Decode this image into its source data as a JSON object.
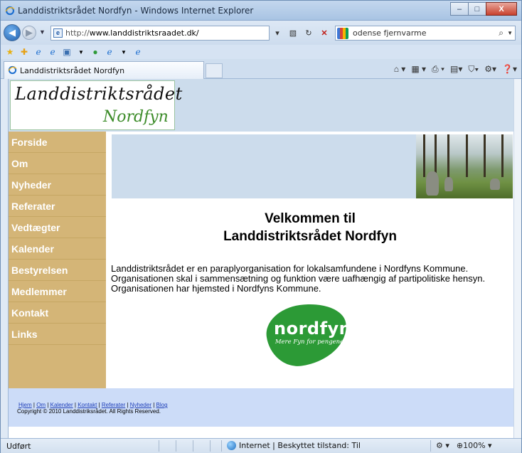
{
  "window": {
    "title": "Landdistriktsrådet Nordfyn - Windows Internet Explorer",
    "controls": {
      "minimize": "–",
      "maximize": "□",
      "close": "X"
    }
  },
  "address": {
    "url_prefix": "http://",
    "url_host": "www.landdistriktsraadet.dk/",
    "search_query": "odense fjernvarme"
  },
  "tab": {
    "label": "Landdistriktsrådet Nordfyn"
  },
  "site": {
    "logo_line1": "Landdistriktsrådet",
    "logo_line2": "Nordfyn",
    "menu": [
      "Forside",
      "Om",
      "Nyheder",
      "Referater",
      "Vedtægter",
      "Kalender",
      "Bestyrelsen",
      "Medlemmer",
      "Kontakt",
      "Links"
    ],
    "heading_line1": "Velkommen til",
    "heading_line2": "Landdistriktsrådet Nordfyn",
    "intro": [
      "Landdistriktsrådet er en paraplyorganisation for lokalsamfundene i Nordfyns Kommune.",
      "Organisationen skal i sammensætning og funktion være uafhængig af partipolitiske hensyn.",
      "Organisationen har hjemsted i Nordfyns Kommune."
    ],
    "nordfyn_logo": {
      "name": "nordfyn",
      "tagline": "Mere Fyn for pengene"
    },
    "footer": {
      "links": [
        "Hjem",
        "Om",
        "Kalender",
        "Kontakt",
        "Referater",
        "Nyheder",
        "Blog"
      ],
      "separator": " | ",
      "copyright": "Copyright © 2010 Landdistriksrådet. All Rights Reserved."
    }
  },
  "status": {
    "left": "Udført",
    "zone": "Internet | Beskyttet tilstand: Til",
    "zoom": "100%"
  },
  "colors": {
    "sidebar": "#d4b577",
    "header": "#ccdcec",
    "footer": "#ccdcf8",
    "logo_green": "#2c9a36"
  }
}
